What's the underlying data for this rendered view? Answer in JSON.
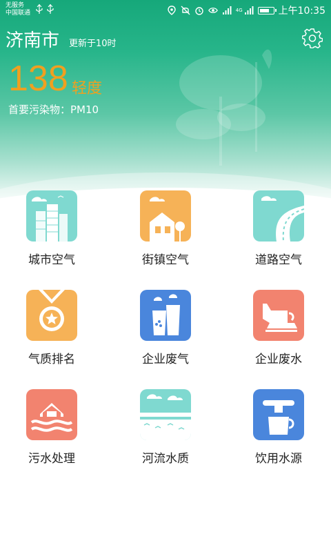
{
  "status_bar": {
    "carrier_line1": "无服务",
    "carrier_line2": "中国联通",
    "network_label": "4G",
    "time": "上午10:35"
  },
  "header": {
    "city": "济南市",
    "updated": "更新于10时",
    "aqi_value": "138",
    "aqi_level": "轻度",
    "primary_pollutant": "首要污染物：PM10"
  },
  "grid": [
    {
      "label": "城市空气",
      "icon": "city-buildings-icon",
      "color": "#7fd9d0"
    },
    {
      "label": "街镇空气",
      "icon": "town-house-icon",
      "color": "#f6b257"
    },
    {
      "label": "道路空气",
      "icon": "road-icon",
      "color": "#7fd9d0"
    },
    {
      "label": "气质排名",
      "icon": "medal-star-icon",
      "color": "#f6b257"
    },
    {
      "label": "企业废气",
      "icon": "factory-icon",
      "color": "#4a86dc"
    },
    {
      "label": "企业废水",
      "icon": "wastewater-pipe-icon",
      "color": "#f2836f"
    },
    {
      "label": "污水处理",
      "icon": "sewage-house-icon",
      "color": "#f2836f"
    },
    {
      "label": "河流水质",
      "icon": "river-icon",
      "color": "#7fd9d0"
    },
    {
      "label": "饮用水源",
      "icon": "water-tap-icon",
      "color": "#4a86dc"
    }
  ],
  "colors": {
    "header_green": "#16a87a",
    "aqi_orange": "#f0a020"
  }
}
